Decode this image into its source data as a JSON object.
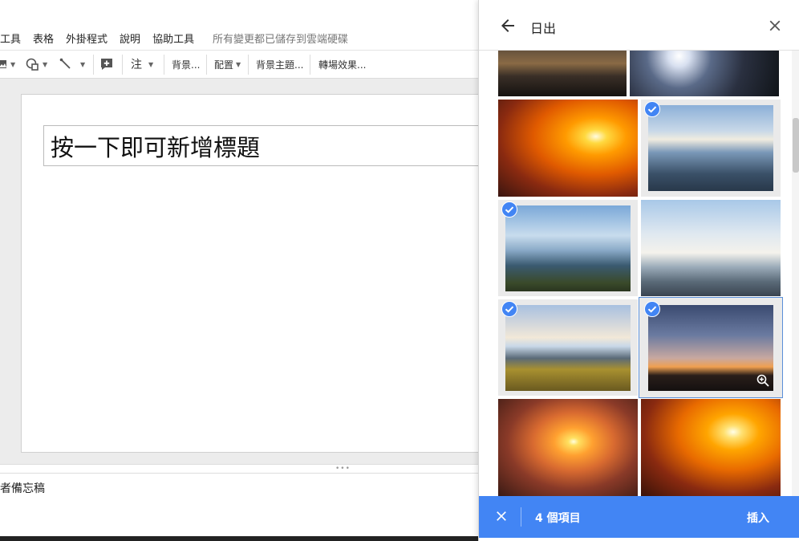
{
  "menu": {
    "items": [
      "工具",
      "表格",
      "外掛程式",
      "說明",
      "協助工具"
    ],
    "save_status": "所有變更都已儲存到雲端硬碟"
  },
  "toolbar": {
    "comment": "注",
    "background": "背景...",
    "layout": "配置",
    "theme": "背景主題...",
    "transition": "轉場效果..."
  },
  "slide": {
    "title_placeholder": "按一下即可新增標題"
  },
  "notes": {
    "text": "者備忘稿"
  },
  "panel": {
    "title": "日出",
    "selected_count": "4 個項目",
    "insert_label": "插入"
  },
  "colors": {
    "accent": "#4285f4",
    "selection_bg": "#eaeaea"
  },
  "icons": {
    "back": "arrow-left-icon",
    "close": "close-icon",
    "check": "check-circle-icon",
    "zoom": "zoom-in-icon",
    "image": "image-icon",
    "shape": "shape-icon",
    "line": "line-icon",
    "new_slide": "add-box-icon"
  },
  "images": [
    {
      "id": "sunset-1",
      "selected": false,
      "focused": false
    },
    {
      "id": "sunset-2",
      "selected": false,
      "focused": false
    },
    {
      "id": "sunrise-orange",
      "selected": false,
      "focused": false
    },
    {
      "id": "mountain-clouds-1",
      "selected": true,
      "focused": false
    },
    {
      "id": "mountain-clouds-2",
      "selected": true,
      "focused": false
    },
    {
      "id": "road-guardrail",
      "selected": false,
      "focused": false
    },
    {
      "id": "grassy-ridge",
      "selected": true,
      "focused": false
    },
    {
      "id": "dusk-horizon",
      "selected": true,
      "focused": true
    },
    {
      "id": "sunburst-1",
      "selected": false,
      "focused": false
    },
    {
      "id": "sunburst-2",
      "selected": false,
      "focused": false
    }
  ]
}
